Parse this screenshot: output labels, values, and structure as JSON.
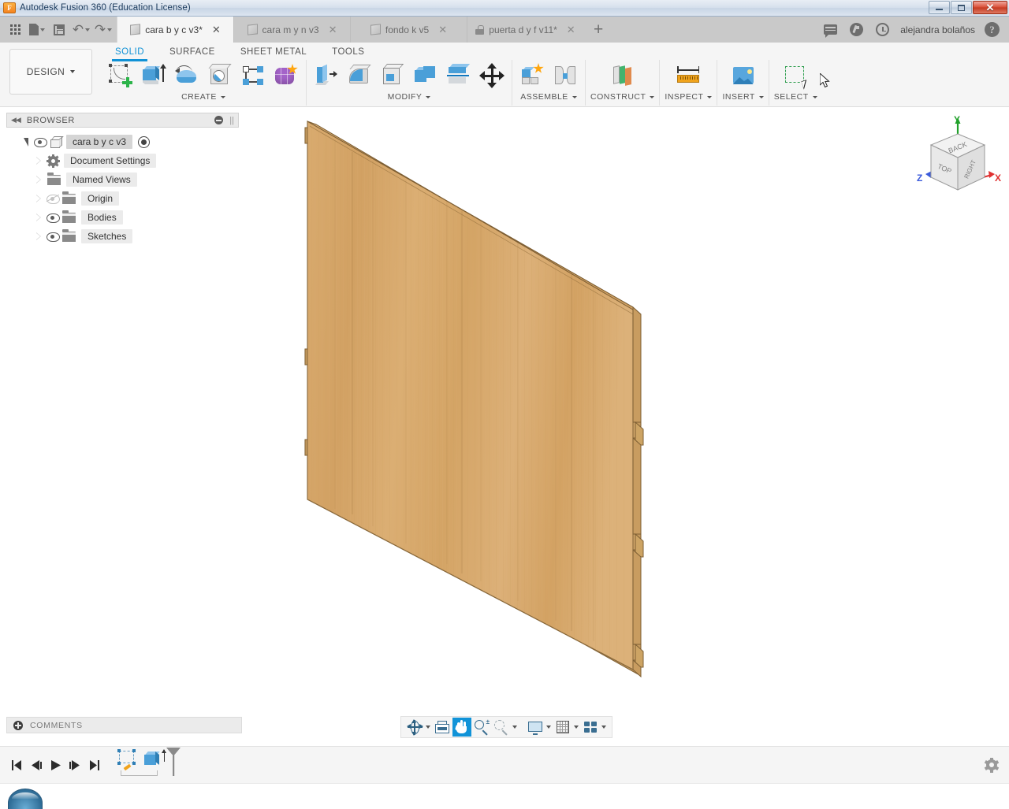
{
  "window": {
    "title": "Autodesk Fusion 360 (Education License)",
    "app_initial": "F",
    "controls": {
      "minimize": "minimize-button",
      "restore": "restore-button",
      "close": "✕"
    }
  },
  "appbar": {
    "quick_access": [
      {
        "name": "apps-grid-icon",
        "label": ""
      },
      {
        "name": "file-icon",
        "label": ""
      },
      {
        "name": "save-icon",
        "label": ""
      },
      {
        "name": "undo-icon",
        "label": "↶"
      },
      {
        "name": "redo-icon",
        "label": "↷"
      }
    ],
    "tabs": [
      {
        "label": "cara b y c v3*",
        "icon": "cube-icon",
        "active": true,
        "close": "✕"
      },
      {
        "label": "cara m y n v3",
        "icon": "cube-icon",
        "active": false,
        "close": "✕"
      },
      {
        "label": "fondo k v5",
        "icon": "cube-icon",
        "active": false,
        "close": "✕"
      },
      {
        "label": "puerta d y f v11*",
        "icon": "lock-icon",
        "active": false,
        "close": "✕"
      }
    ],
    "new_tab": "+",
    "username": "alejandra bolaños",
    "help": "?"
  },
  "ribbon": {
    "design_button": "DESIGN",
    "workspace_tabs": [
      {
        "label": "SOLID",
        "active": true
      },
      {
        "label": "SURFACE",
        "active": false
      },
      {
        "label": "SHEET METAL",
        "active": false
      },
      {
        "label": "TOOLS",
        "active": false
      }
    ],
    "groups": [
      {
        "label": "CREATE",
        "has_dropdown": true,
        "icons": [
          "create-sketch-icon",
          "extrude-icon",
          "revolve-icon",
          "sweep-icon",
          "loft-icon",
          "create-form-icon"
        ]
      },
      {
        "label": "MODIFY",
        "has_dropdown": true,
        "icons": [
          "press-pull-icon",
          "fillet-icon",
          "shell-icon",
          "combine-icon",
          "split-face-icon",
          "move-copy-icon"
        ]
      },
      {
        "label": "ASSEMBLE",
        "has_dropdown": true,
        "icons": [
          "new-component-icon",
          "joint-icon"
        ]
      },
      {
        "label": "CONSTRUCT",
        "has_dropdown": true,
        "icons": [
          "offset-plane-icon"
        ]
      },
      {
        "label": "INSPECT",
        "has_dropdown": true,
        "icons": [
          "measure-icon"
        ]
      },
      {
        "label": "INSERT",
        "has_dropdown": true,
        "icons": [
          "insert-image-icon"
        ]
      },
      {
        "label": "SELECT",
        "has_dropdown": true,
        "icons": [
          "select-window-icon"
        ]
      }
    ]
  },
  "browser": {
    "header": "BROWSER",
    "collapse_icon": "collapse-left-icon",
    "nodes": [
      {
        "label": "cara b y c v3",
        "icon": "component-cube-icon",
        "depth": 0,
        "expanded": true,
        "eye": "visible",
        "has_radio": true
      },
      {
        "label": "Document Settings",
        "icon": "gear-icon",
        "depth": 1,
        "expanded": false,
        "eye": "none",
        "has_radio": false
      },
      {
        "label": "Named Views",
        "icon": "folder-icon",
        "depth": 1,
        "expanded": false,
        "eye": "none",
        "has_radio": false
      },
      {
        "label": "Origin",
        "icon": "folder-icon",
        "depth": 1,
        "expanded": false,
        "eye": "hidden",
        "has_radio": false
      },
      {
        "label": "Bodies",
        "icon": "folder-icon",
        "depth": 1,
        "expanded": false,
        "eye": "visible",
        "has_radio": false
      },
      {
        "label": "Sketches",
        "icon": "folder-icon",
        "depth": 1,
        "expanded": false,
        "eye": "visible",
        "has_radio": false
      }
    ]
  },
  "viewcube": {
    "front_face": "TOP",
    "top_face": "BACK",
    "right_face": "RIGHT",
    "axes": [
      {
        "label": "Y",
        "color": "#21a12b"
      },
      {
        "label": "X",
        "color": "#e03030"
      },
      {
        "label": "Z",
        "color": "#3b5bdb"
      }
    ]
  },
  "model": {
    "material": "wood",
    "face_color": "#d9ab6e",
    "edge_color": "#8c6a3c",
    "description": "wooden panel with edge notches"
  },
  "navbar": {
    "buttons": [
      {
        "name": "orbit-button",
        "active": false,
        "dropdown": true
      },
      {
        "name": "look-at-button",
        "active": false,
        "dropdown": false
      },
      {
        "name": "pan-button",
        "active": true,
        "dropdown": false
      },
      {
        "name": "zoom-button",
        "active": false,
        "dropdown": false
      },
      {
        "name": "fit-button",
        "active": false,
        "dropdown": true
      },
      {
        "name": "display-settings-button",
        "active": false,
        "dropdown": true
      },
      {
        "name": "grid-snaps-button",
        "active": false,
        "dropdown": true
      },
      {
        "name": "viewports-button",
        "active": false,
        "dropdown": true
      }
    ]
  },
  "comments": {
    "label": "COMMENTS",
    "add_icon": "add-comment-icon"
  },
  "timeline": {
    "controls": [
      {
        "name": "go-to-beginning-button",
        "glyph": "⏮"
      },
      {
        "name": "step-back-button",
        "glyph": "◀|"
      },
      {
        "name": "play-button",
        "glyph": "▶"
      },
      {
        "name": "step-forward-button",
        "glyph": "|▶"
      },
      {
        "name": "go-to-end-button",
        "glyph": "⏭"
      }
    ],
    "features": [
      {
        "name": "sketch-feature",
        "icon": "sketch-feature-icon"
      },
      {
        "name": "extrude-feature",
        "icon": "extrude-feature-icon"
      }
    ],
    "settings_icon": "timeline-settings-gear-icon"
  }
}
